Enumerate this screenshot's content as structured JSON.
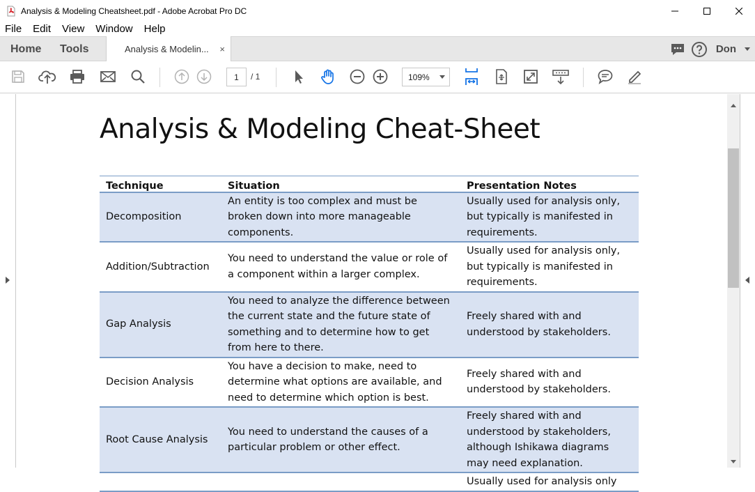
{
  "window": {
    "title": "Analysis & Modeling Cheatsheet.pdf - Adobe Acrobat Pro DC"
  },
  "menu": [
    "File",
    "Edit",
    "View",
    "Window",
    "Help"
  ],
  "tabs": {
    "home": "Home",
    "tools": "Tools",
    "document": "Analysis & Modelin...",
    "close": "×",
    "user": "Don"
  },
  "toolbar": {
    "page_current": "1",
    "page_total": "/ 1",
    "zoom": "109%",
    "icons": [
      "save-icon",
      "upload-cloud-icon",
      "print-icon",
      "email-icon",
      "search-icon",
      "page-up-icon",
      "page-down-icon",
      "select-pointer-icon",
      "hand-tool-icon",
      "zoom-out-icon",
      "zoom-in-icon",
      "fit-width-icon",
      "rotate-icon",
      "full-screen-icon",
      "read-mode-icon",
      "comment-icon",
      "sign-icon"
    ],
    "accent": "#1473e6"
  },
  "document": {
    "title": "Analysis & Modeling Cheat-Sheet",
    "table": {
      "headers": [
        "Technique",
        "Situation",
        "Presentation Notes"
      ],
      "rows": [
        {
          "technique": "Decomposition",
          "situation": "An entity is too complex and must be broken down into more manageable components.",
          "notes": "Usually used for analysis only, but typically is manifested in requirements."
        },
        {
          "technique": "Addition/Subtraction",
          "situation": "You need to understand the value or role of a component within a larger complex.",
          "notes": "Usually used for analysis only, but typically is manifested in requirements."
        },
        {
          "technique": "Gap Analysis",
          "situation": "You need to analyze the difference between the current state and the future state of something and to determine how to get from here to there.",
          "notes": "Freely shared with and understood by stakeholders."
        },
        {
          "technique": "Decision Analysis",
          "situation": "You have a decision to make, need to determine what options are available, and need to determine which option is best.",
          "notes": "Freely shared with and understood by stakeholders."
        },
        {
          "technique": "Root Cause Analysis",
          "situation": "You need to understand the causes of a particular problem or other effect.",
          "notes": "Freely shared with and understood by stakeholders, although Ishikawa diagrams may need explanation."
        },
        {
          "technique": "",
          "situation": "",
          "notes": "Usually used for analysis only"
        }
      ]
    }
  }
}
